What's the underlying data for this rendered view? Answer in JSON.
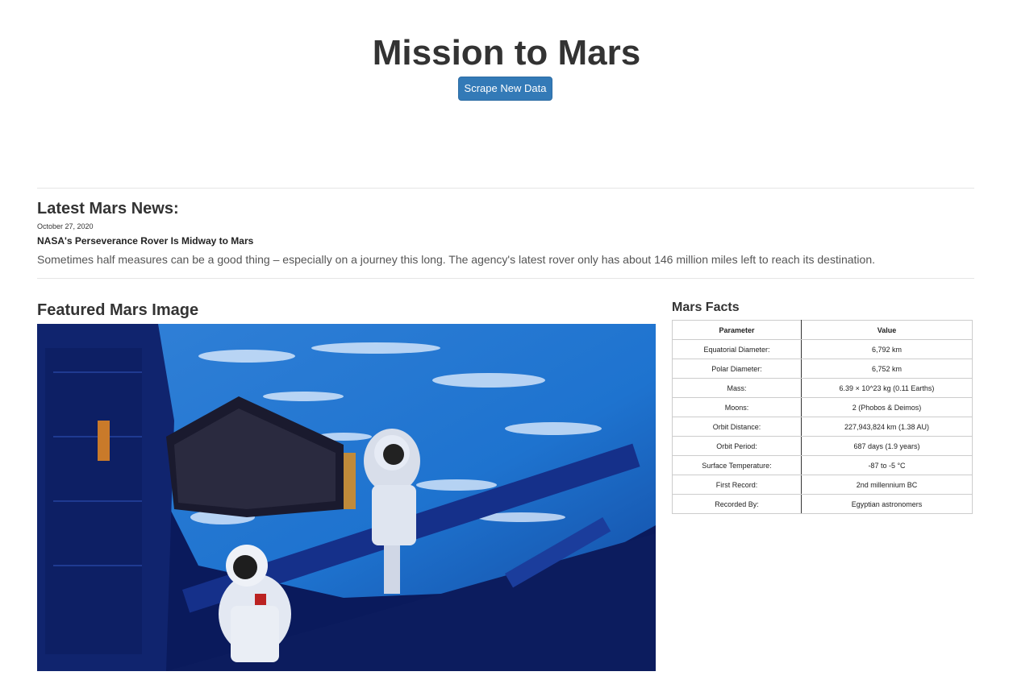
{
  "header": {
    "title": "Mission to Mars",
    "scrape_button_label": "Scrape New Data"
  },
  "news": {
    "heading": "Latest Mars News:",
    "date": "October 27, 2020",
    "title": "NASA's Perseverance Rover Is Midway to Mars",
    "teaser": "Sometimes half measures can be a good thing – especially on a journey this long. The agency's latest rover only has about 146 million miles left to reach its destination."
  },
  "featured_image": {
    "heading": "Featured Mars Image",
    "subject": "astronauts-spacewalk-photo"
  },
  "facts": {
    "heading": "Mars Facts",
    "columns": [
      "Parameter",
      "Value"
    ],
    "rows": [
      [
        "Equatorial Diameter:",
        "6,792 km"
      ],
      [
        "Polar Diameter:",
        "6,752 km"
      ],
      [
        "Mass:",
        "6.39 × 10^23 kg (0.11 Earths)"
      ],
      [
        "Moons:",
        "2 (Phobos & Deimos)"
      ],
      [
        "Orbit Distance:",
        "227,943,824 km (1.38 AU)"
      ],
      [
        "Orbit Period:",
        "687 days (1.9 years)"
      ],
      [
        "Surface Temperature:",
        "-87 to -5 °C"
      ],
      [
        "First Record:",
        "2nd millennium BC"
      ],
      [
        "Recorded By:",
        "Egyptian astronomers"
      ]
    ]
  },
  "colors": {
    "button_bg": "#337ab7",
    "text": "#333333",
    "divider": "#e5e5e5"
  }
}
